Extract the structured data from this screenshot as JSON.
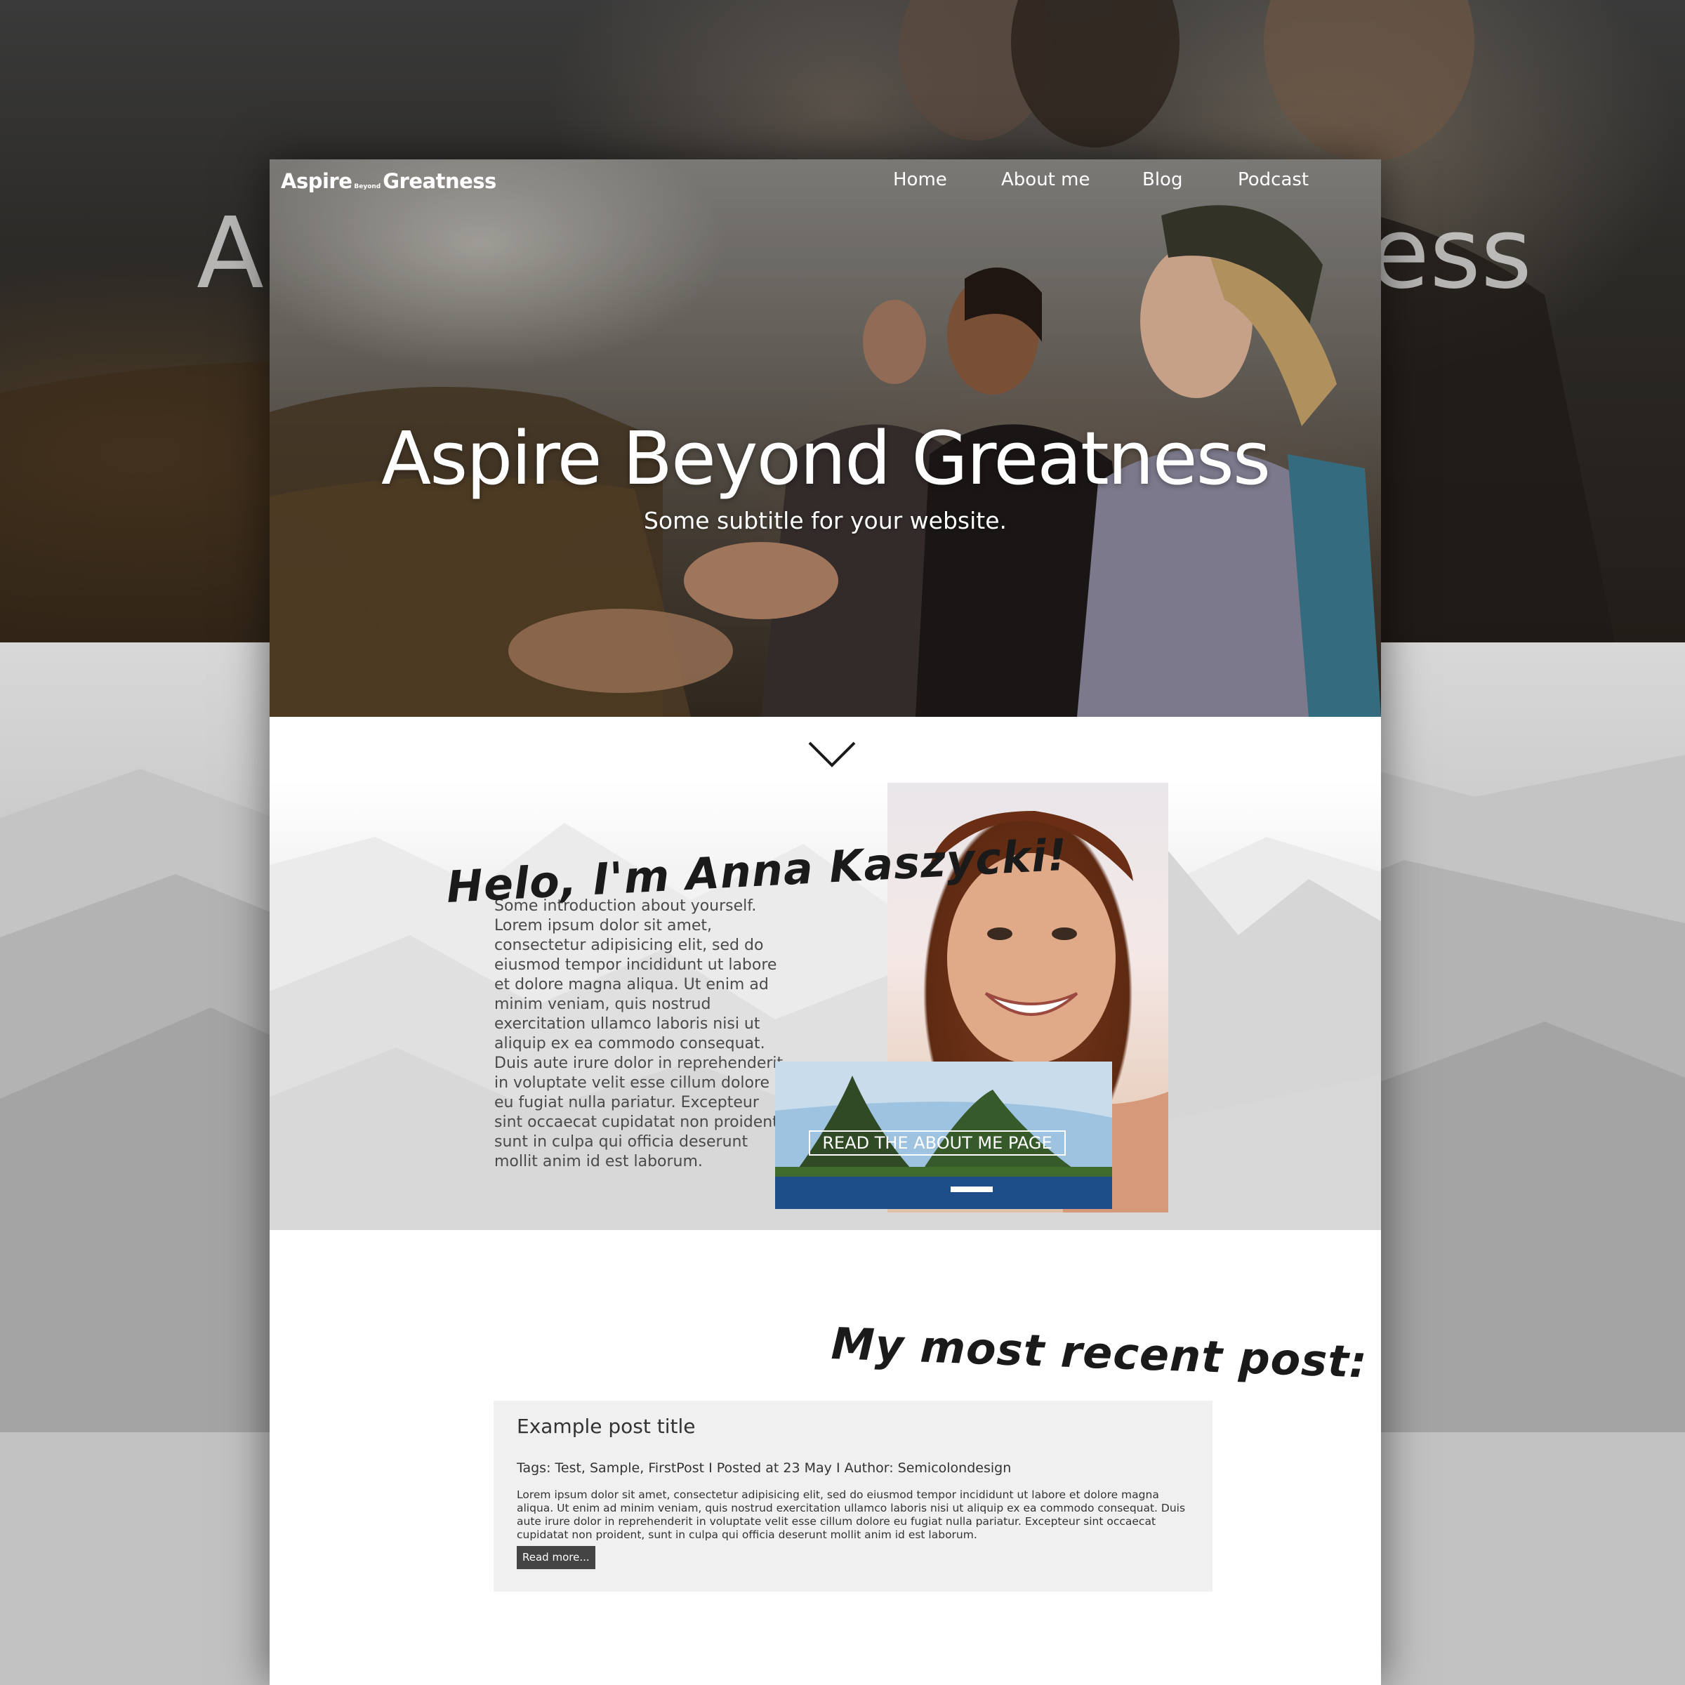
{
  "background": {
    "title_fragment_left": "A",
    "title_fragment_right": "ess"
  },
  "navbar": {
    "logo": {
      "part1": "Aspire",
      "part2": "Beyond",
      "part3": "Greatness"
    },
    "links": [
      "Home",
      "About me",
      "Blog",
      "Podcast"
    ]
  },
  "hero": {
    "title": "Aspire Beyond Greatness",
    "subtitle": "Some subtitle for your website."
  },
  "about": {
    "heading": "Helo, I'm Anna Kaszycki!",
    "text": "Some introduction about yourself. Lorem ipsum dolor sit amet, consectetur adipisicing elit, sed do eiusmod tempor incididunt ut labore et dolore magna aliqua. Ut enim ad minim veniam, quis nostrud exercitation ullamco laboris nisi ut aliquip ex ea commodo consequat. Duis aute irure dolor in reprehenderit in voluptate velit esse cillum dolore eu fugiat nulla pariatur. Excepteur sint occaecat cupidatat non proident, sunt in culpa qui officia deserunt mollit anim id est laborum.",
    "cta": "READ THE ABOUT ME PAGE"
  },
  "recent": {
    "heading": "My most recent post:",
    "post": {
      "title": "Example post title",
      "meta": "Tags: Test, Sample, FirstPost I Posted at 23 May I Author: Semicolondesign",
      "body": "Lorem ipsum dolor sit amet, consectetur adipisicing elit, sed do eiusmod tempor incididunt ut labore et dolore magna aliqua. Ut enim ad minim veniam, quis nostrud exercitation ullamco laboris nisi ut aliquip ex ea commodo consequat. Duis aute irure dolor in reprehenderit in voluptate velit esse cillum dolore eu fugiat nulla pariatur. Excepteur sint occaecat cupidatat non proident, sunt in culpa qui officia deserunt mollit anim id est laborum.",
      "read_more": "Read more..."
    }
  },
  "colors": {
    "card_bg": "#f0f0f0",
    "button_bg": "#444444",
    "heading": "#1a1a1a",
    "body_text": "#4a4a4a"
  },
  "icons": {
    "scroll": "chevron-down-icon"
  }
}
